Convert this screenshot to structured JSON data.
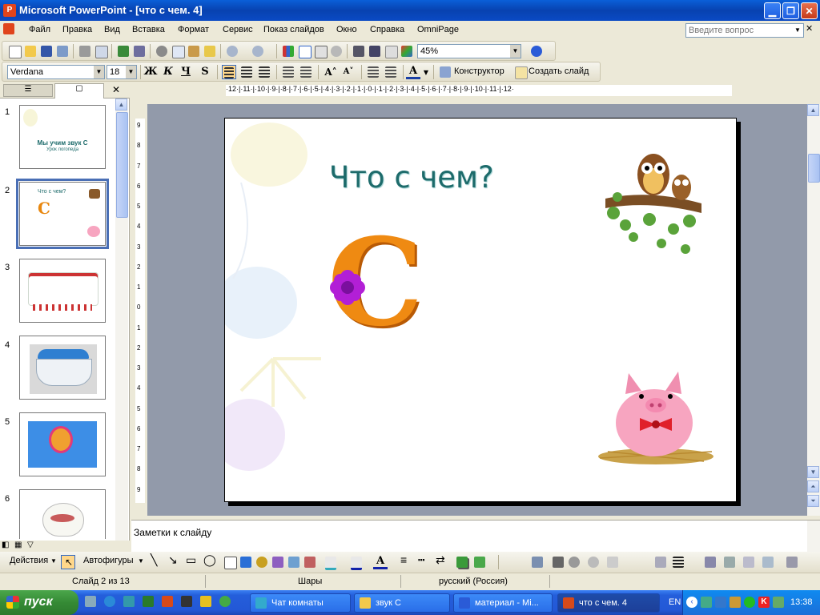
{
  "window": {
    "title": "Microsoft PowerPoint - [что с чем. 4]",
    "app_icon": "P"
  },
  "menu": {
    "items": [
      "Файл",
      "Правка",
      "Вид",
      "Вставка",
      "Формат",
      "Сервис",
      "Показ слайдов",
      "Окно",
      "Справка",
      "OmniPage"
    ],
    "help_placeholder": "Введите вопрос"
  },
  "standard_toolbar": {
    "zoom": "45%"
  },
  "format_toolbar": {
    "font": "Verdana",
    "size": "18",
    "bold": "Ж",
    "italic": "К",
    "underline": "Ч",
    "shadow": "S",
    "designer": "Конструктор",
    "new_slide": "Создать слайд"
  },
  "ruler": {
    "horizontal": "·12·|·11·|·10·|·9·|·8·|·7·|·6·|·5·|·4·|·3·|·2·|·1·|·0·|·1·|·2·|·3·|·4·|·5·|·6·|·7·|·8·|·9·|·10·|·11·|·12·",
    "vertical": [
      "9",
      "8",
      "7",
      "6",
      "5",
      "4",
      "3",
      "2",
      "1",
      "0",
      "1",
      "2",
      "3",
      "4",
      "5",
      "6",
      "7",
      "8",
      "9"
    ]
  },
  "slides": [
    {
      "num": "1",
      "title": "Мы учим звук С",
      "subtitle": "Урок логопеда"
    },
    {
      "num": "2",
      "title": "Что с чем?"
    },
    {
      "num": "3"
    },
    {
      "num": "4"
    },
    {
      "num": "5"
    },
    {
      "num": "6"
    }
  ],
  "current_slide": {
    "title": "Что с чем?",
    "letter": "C"
  },
  "notes": {
    "placeholder": "Заметки к слайду"
  },
  "draw_toolbar": {
    "actions": "Действия",
    "autoshapes": "Автофигуры"
  },
  "status": {
    "slide": "Слайд 2 из 13",
    "design": "Шары",
    "language": "русский (Россия)"
  },
  "taskbar": {
    "start": "пуск",
    "items": [
      "Чат комнаты",
      "звук С",
      "материал - Mi...",
      "что с чем. 4"
    ],
    "lang": "EN",
    "clock": "13:38"
  },
  "colors": {
    "title_bar": "#0a4ac4",
    "slide_title": "#1d6b6b",
    "taskbar": "#245edb",
    "start": "#358a35"
  }
}
